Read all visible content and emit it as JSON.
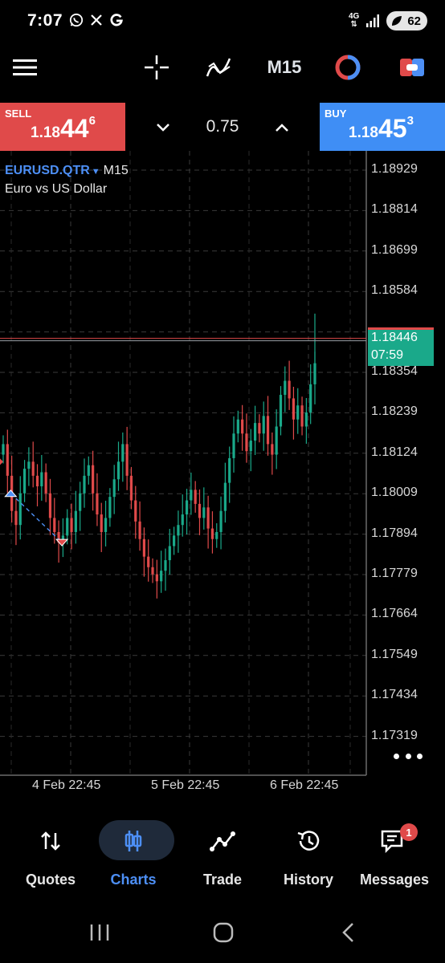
{
  "status": {
    "time": "7:07",
    "network": "4G",
    "battery": "62",
    "icons": [
      "whatsapp-icon",
      "x-icon",
      "google-icon",
      "signal-icon",
      "battery-saver-icon"
    ]
  },
  "toolbar": {
    "timeframe": "M15",
    "icons": [
      "menu-icon",
      "crosshair-icon",
      "indicators-icon",
      "timeframe",
      "oneclick-icon",
      "trade-toggle-icon"
    ]
  },
  "trade": {
    "sell_label": "SELL",
    "sell_price_small": "1.18",
    "sell_price_big": "44",
    "sell_price_sup": "6",
    "lot": "0.75",
    "buy_label": "BUY",
    "buy_price_small": "1.18",
    "buy_price_big": "45",
    "buy_price_sup": "3"
  },
  "chart": {
    "symbol": "EURUSD.QTR",
    "timeframe": "M15",
    "description": "Euro vs US Dollar",
    "current_price": "1.18446",
    "countdown": "07:59",
    "price_ticks": [
      "1.18929",
      "1.18814",
      "1.18699",
      "1.18584",
      "1.18469",
      "1.18354",
      "1.18239",
      "1.18124",
      "1.18009",
      "1.17894",
      "1.17779",
      "1.17664",
      "1.17549",
      "1.17434",
      "1.17319"
    ],
    "date_ticks": [
      "4 Feb 22:45",
      "5 Feb 22:45",
      "6 Feb 22:45"
    ],
    "colors": {
      "bull": "#1aa98a",
      "bear": "#e04a4a",
      "accent": "#4d8ff5"
    }
  },
  "chart_data": {
    "type": "candlestick",
    "symbol": "EURUSD.QTR",
    "timeframe": "M15",
    "ylim": [
      1.1727,
      1.1898
    ],
    "current_price": 1.18446,
    "x_ticks": [
      "4 Feb 22:45",
      "5 Feb 22:45",
      "6 Feb 22:45"
    ],
    "y_ticks": [
      1.18929,
      1.18814,
      1.18699,
      1.18584,
      1.18469,
      1.18354,
      1.18239,
      1.18124,
      1.18009,
      1.17894,
      1.17779,
      1.17664,
      1.17549,
      1.17434,
      1.17319
    ],
    "close": [
      1.1815,
      1.1806,
      1.1796,
      1.1792,
      1.1801,
      1.1808,
      1.181,
      1.1806,
      1.1803,
      1.1807,
      1.1801,
      1.1794,
      1.179,
      1.1787,
      1.1789,
      1.1794,
      1.179,
      1.1796,
      1.1801,
      1.1806,
      1.1809,
      1.1801,
      1.1795,
      1.179,
      1.1794,
      1.18,
      1.1805,
      1.181,
      1.1815,
      1.1806,
      1.1799,
      1.1793,
      1.1788,
      1.1783,
      1.178,
      1.1778,
      1.1776,
      1.1779,
      1.1782,
      1.1786,
      1.1789,
      1.1792,
      1.1795,
      1.1799,
      1.1802,
      1.1798,
      1.1794,
      1.1797,
      1.1791,
      1.1788,
      1.179,
      1.1796,
      1.1804,
      1.1811,
      1.1818,
      1.1822,
      1.1818,
      1.1813,
      1.1816,
      1.1821,
      1.1818,
      1.1823,
      1.1815,
      1.1812,
      1.182,
      1.1829,
      1.1833,
      1.1828,
      1.1822,
      1.1826,
      1.182,
      1.1824,
      1.1832,
      1.1838
    ],
    "markers": [
      {
        "type": "buy",
        "x_index": 1,
        "price": 1.1801
      },
      {
        "type": "sell",
        "x_index": 13,
        "price": 1.1787
      }
    ]
  }
}
